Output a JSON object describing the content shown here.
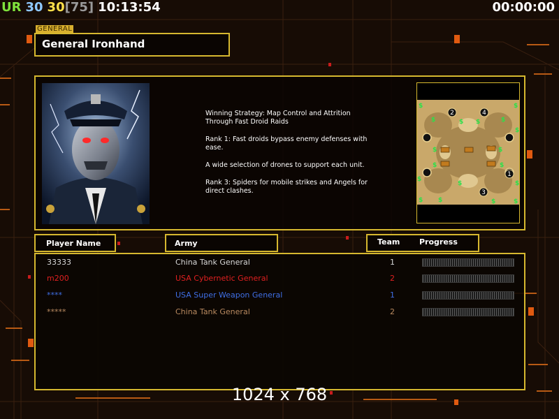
{
  "hud": {
    "label": "UR",
    "value1": "30",
    "value2": "30",
    "bracket": "[75]",
    "time": "10:13:54",
    "timer": "00:00:00",
    "colors": {
      "label": "#7fe23c",
      "value1": "#8fc8ff",
      "value2": "#ffe04a",
      "bracket": "#9a9a9a"
    }
  },
  "general": {
    "tag": "GENERAL",
    "name": "General Ironhand"
  },
  "description": [
    "Winning Strategy: Map Control and Attrition\n Through Fast Droid Raids",
    "Rank 1: Fast droids bypass enemy defenses with\n ease.",
    "A wide selection of drones to support each unit.",
    "Rank 3: Spiders for mobile strikes and Angels for\n direct clashes."
  ],
  "minimap": {
    "start_positions": [
      "1",
      "2",
      "3",
      "4"
    ],
    "supply_marker": "$"
  },
  "table": {
    "headers": {
      "player": "Player Name",
      "army": "Army",
      "team": "Team",
      "progress": "Progress"
    },
    "rows": [
      {
        "player": "33333",
        "army": "China Tank General",
        "team": "1",
        "color": "#d8d8d8",
        "progress": 0
      },
      {
        "player": "m200",
        "army": "USA Cybernetic General",
        "team": "2",
        "color": "#e02020",
        "progress": 0
      },
      {
        "player": "****",
        "army": "USA Super Weapon General",
        "team": "1",
        "color": "#3f6fe6",
        "progress": 0
      },
      {
        "player": "*****",
        "army": "China Tank General",
        "team": "2",
        "color": "#b98a60",
        "progress": 0
      }
    ]
  },
  "resolution": "1024 x 768",
  "accent_color": "#d6b82f"
}
